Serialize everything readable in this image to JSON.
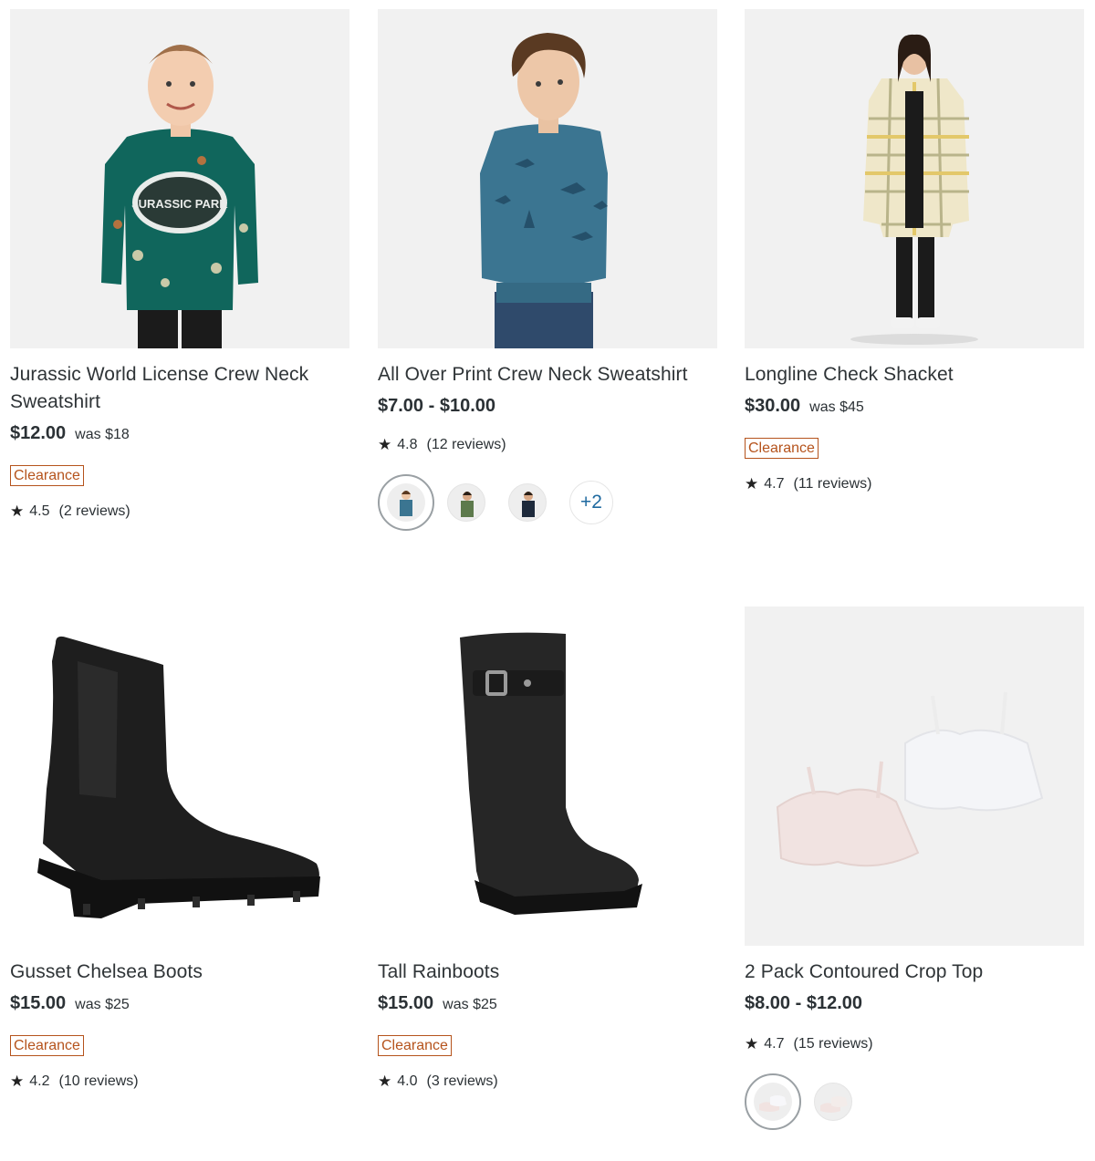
{
  "products": [
    {
      "image_icon": "kids-dino-sweatshirt-image",
      "title": "Jurassic World License Crew Neck Sweatshirt",
      "price": "$12.00",
      "was": "was $18",
      "badge": "Clearance",
      "rating": "4.5",
      "reviews": "(2 reviews)",
      "print": "JURASSIC PARK"
    },
    {
      "image_icon": "kids-wolf-sweatshirt-image",
      "title": "All Over Print Crew Neck Sweatshirt",
      "price": "$7.00 - $10.00",
      "rating": "4.8",
      "reviews": "(12 reviews)",
      "swatches_more": "+2"
    },
    {
      "image_icon": "check-shacket-image",
      "title": "Longline Check Shacket",
      "price": "$30.00",
      "was": "was $45",
      "badge": "Clearance",
      "rating": "4.7",
      "reviews": "(11 reviews)"
    },
    {
      "image_icon": "chelsea-boot-image",
      "title": "Gusset Chelsea Boots",
      "price": "$15.00",
      "was": "was $25",
      "badge": "Clearance",
      "rating": "4.2",
      "reviews": "(10 reviews)"
    },
    {
      "image_icon": "rainboot-image",
      "title": "Tall Rainboots",
      "price": "$15.00",
      "was": "was $25",
      "badge": "Clearance",
      "rating": "4.0",
      "reviews": "(3 reviews)"
    },
    {
      "image_icon": "crop-top-bras-image",
      "title": "2 Pack Contoured Crop Top",
      "price": "$8.00 - $12.00",
      "rating": "4.7",
      "reviews": "(15 reviews)"
    }
  ],
  "colors": {
    "text": "#2b3135",
    "clearance": "#b5531c",
    "more_link": "#1f6aa0",
    "image_bg": "#f1f1f1"
  },
  "icons": {
    "star": "★"
  }
}
